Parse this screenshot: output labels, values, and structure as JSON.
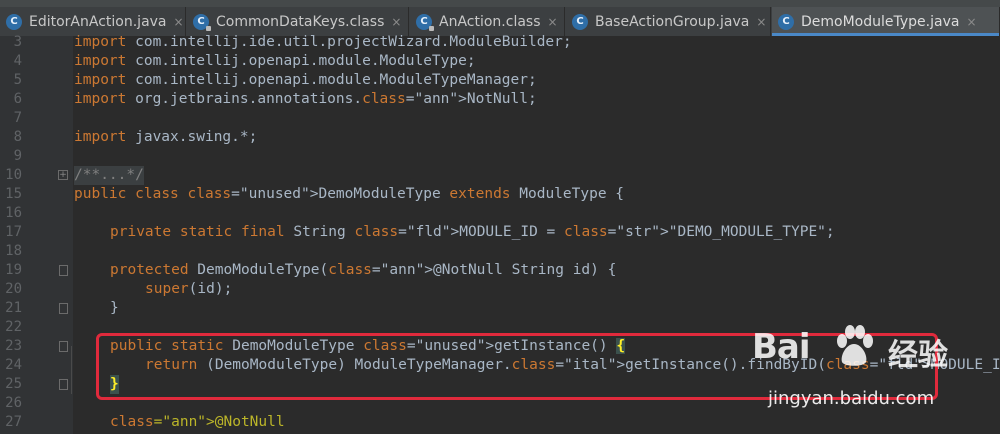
{
  "tabs": [
    {
      "label": "EditorAnAction.java",
      "icon": "java-class-icon",
      "active": false
    },
    {
      "label": "CommonDataKeys.class",
      "icon": "java-class-icon",
      "active": false
    },
    {
      "label": "AnAction.class",
      "icon": "java-class-icon",
      "active": false
    },
    {
      "label": "BaseActionGroup.java",
      "icon": "java-class-icon",
      "active": false
    },
    {
      "label": "DemoModuleType.java",
      "icon": "java-class-icon",
      "active": true
    }
  ],
  "close_glyph": "×",
  "icon_letter": "C",
  "lines": [
    {
      "num": "3",
      "code": "import com.intellij.ide.util.projectWizard.ModuleBuilder;"
    },
    {
      "num": "4",
      "code": "import com.intellij.openapi.module.ModuleType;"
    },
    {
      "num": "5",
      "code": "import com.intellij.openapi.module.ModuleTypeManager;"
    },
    {
      "num": "6",
      "code": "import org.jetbrains.annotations.NotNull;"
    },
    {
      "num": "7",
      "code": ""
    },
    {
      "num": "8",
      "code": "import javax.swing.*;"
    },
    {
      "num": "9",
      "code": ""
    },
    {
      "num": "10",
      "code": "/**...*/"
    },
    {
      "num": "15",
      "code": "public class DemoModuleType extends ModuleType {"
    },
    {
      "num": "16",
      "code": ""
    },
    {
      "num": "17",
      "code": "private static final String MODULE_ID = \"DEMO_MODULE_TYPE\";"
    },
    {
      "num": "18",
      "code": ""
    },
    {
      "num": "19",
      "code": "protected DemoModuleType(@NotNull String id) {"
    },
    {
      "num": "20",
      "code": "super(id);"
    },
    {
      "num": "21",
      "code": "}"
    },
    {
      "num": "22",
      "code": ""
    },
    {
      "num": "23",
      "code": "public static DemoModuleType getInstance() {"
    },
    {
      "num": "24",
      "code": "return (DemoModuleType) ModuleTypeManager.getInstance().findByID(MODULE_ID);"
    },
    {
      "num": "25",
      "code": "}"
    },
    {
      "num": "26",
      "code": ""
    },
    {
      "num": "27",
      "code": "@NotNull"
    }
  ],
  "watermark": {
    "brand": "Bai",
    "brand_tail": "经验",
    "url": "jingyan.baidu.com"
  },
  "colors": {
    "keyword": "#cc7832",
    "string": "#6a8759",
    "annotation": "#bbb529",
    "field": "#9876aa",
    "highlight_box": "#e02a3c",
    "tab_accent": "#4a88c7"
  }
}
